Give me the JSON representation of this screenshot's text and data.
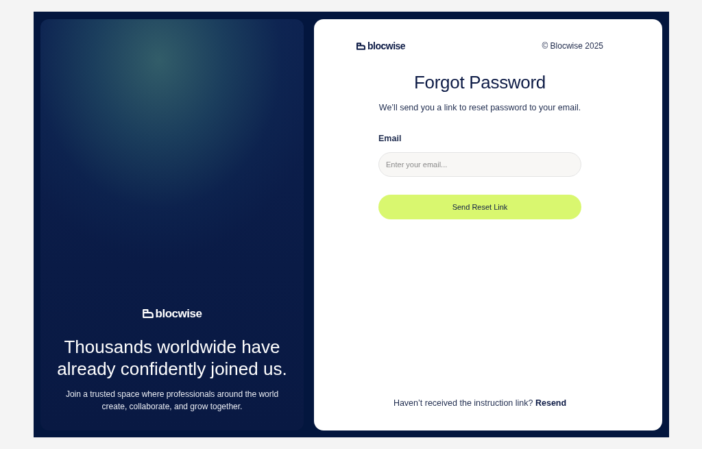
{
  "brand_panel": {
    "logo_text": "blocwise",
    "headline": "Thousands worldwide have already confidently joined us.",
    "description": "Join a trusted space where professionals around the world create, collaborate, and grow together."
  },
  "form_card": {
    "logo_text": "blocwise",
    "copyright": "© Blocwise 2025",
    "title": "Forgot Password",
    "subtitle": "We’ll send you a link to reset password to your email.",
    "email_field": {
      "label": "Email",
      "placeholder": "Enter your email..."
    },
    "submit_button": "Send Reset Link",
    "footer": {
      "text": "Haven’t received the instruction link?",
      "link": "Resend"
    }
  }
}
